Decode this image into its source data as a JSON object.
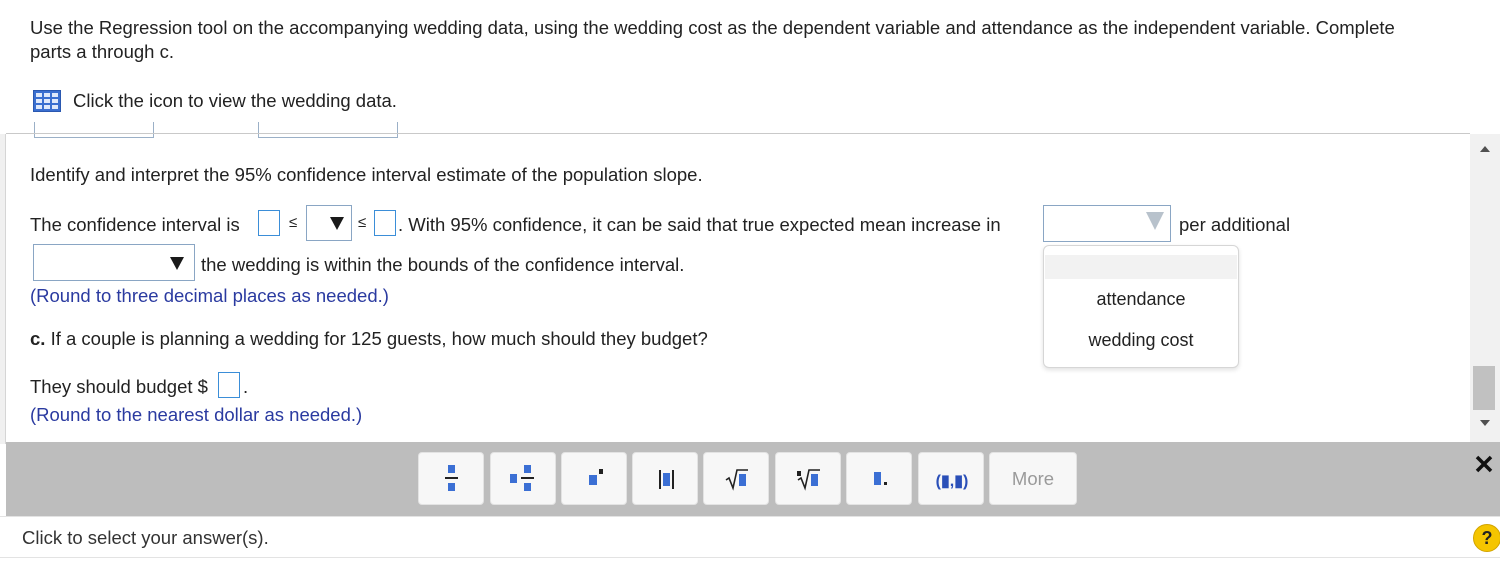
{
  "question": {
    "line1": "Use the Regression tool on the accompanying wedding data, using the wedding cost as the dependent variable and attendance as the independent variable. Complete",
    "line2": "parts a through c."
  },
  "data_link": {
    "icon": "grid-table-icon",
    "text": "Click the icon to view the wedding data."
  },
  "part_b": {
    "prompt": "Identify and interpret the 95% confidence interval estimate of the population slope.",
    "ci_prefix": "The confidence interval is",
    "leq_symbol": "≤",
    "ci_mid_text": ". With 95% confidence, it can be said that true expected mean increase in",
    "per_additional": "per additional",
    "bounds_text": "the wedding is within the bounds of the confidence interval.",
    "round_note": "(Round to three decimal places as needed.)",
    "lower_value": "",
    "upper_value": "",
    "slope_symbol_selected": "",
    "variable_1_selected": "",
    "variable_2_selected": ""
  },
  "dropdown_options": [
    "attendance",
    "wedding cost"
  ],
  "part_c": {
    "label": "c.",
    "prompt": "If a couple is planning a wedding for 125 guests, how much should they budget?",
    "answer_prefix": "They should budget $",
    "answer_suffix": ".",
    "answer_value": "",
    "round_note": "(Round to the nearest dollar as needed.)"
  },
  "toolbar": {
    "buttons": [
      "fraction-icon",
      "mixed-number-icon",
      "exponent-icon",
      "absolute-value-icon",
      "square-root-icon",
      "nth-root-icon",
      "decimal-icon",
      "ordered-pair-icon"
    ],
    "ordered_pair_label": "(▮,▮)",
    "more_label": "More",
    "close_icon": "close-icon"
  },
  "footer": {
    "status": "Click to select your answer(s).",
    "help_label": "?"
  },
  "colors": {
    "accent_blue": "#2a3aa0",
    "input_border": "#3b8ed8",
    "toolbar_bg": "#bdbdbd",
    "help_yellow": "#f5c500"
  }
}
